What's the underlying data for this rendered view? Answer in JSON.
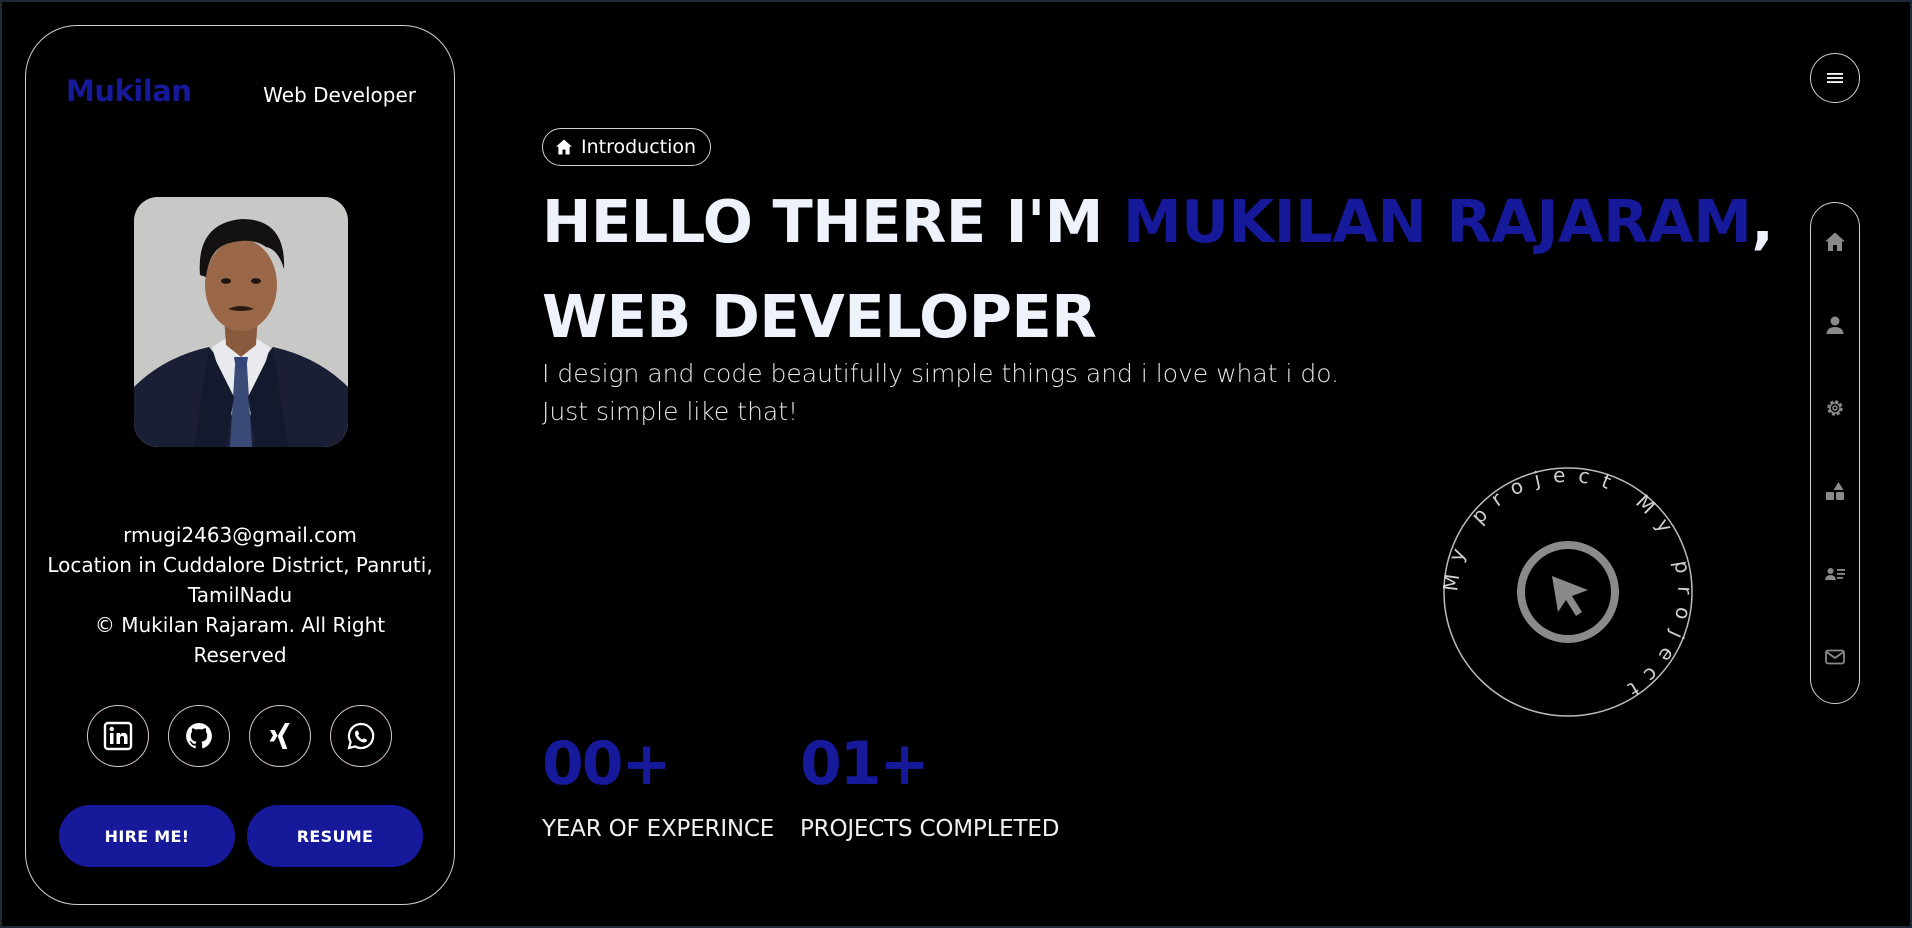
{
  "brand": {
    "name": "Mukilan",
    "role": "Web Developer"
  },
  "profile": {
    "email": "rmugi2463@gmail.com",
    "location_line1": "Location in Cuddalore District, Panruti,",
    "location_line2": "TamilNadu",
    "copyright": "© Mukilan Rajaram. All Right Reserved"
  },
  "socials": [
    {
      "icon": "linkedin-icon"
    },
    {
      "icon": "github-icon"
    },
    {
      "icon": "xing-icon"
    },
    {
      "icon": "whatsapp-icon"
    }
  ],
  "buttons": {
    "hire": "HIRE ME!",
    "resume": "RESUME"
  },
  "hero": {
    "tag": "Introduction",
    "line1_prefix": "HELLO THERE I'M ",
    "name_highlight": "MUKILAN RAJARAM",
    "line1_suffix": ",",
    "line2": "WEB DEVELOPER",
    "intro_line1": "I design and code beautifully simple things and i love what i do.",
    "intro_line2": "Just simple like that!"
  },
  "stats": [
    {
      "value": "00+",
      "label": "YEAR OF EXPERINCE"
    },
    {
      "value": "01+",
      "label": "PROJECTS COMPLETED"
    }
  ],
  "badge": {
    "text": "My project My project"
  },
  "nav": [
    {
      "icon": "home-icon"
    },
    {
      "icon": "user-icon"
    },
    {
      "icon": "gear-icon"
    },
    {
      "icon": "shapes-icon"
    },
    {
      "icon": "contact-card-icon"
    },
    {
      "icon": "mail-icon"
    }
  ],
  "colors": {
    "accent": "#16199a",
    "background": "#000000",
    "text": "#eef2fb",
    "icon_gray": "#8a8a8a"
  }
}
